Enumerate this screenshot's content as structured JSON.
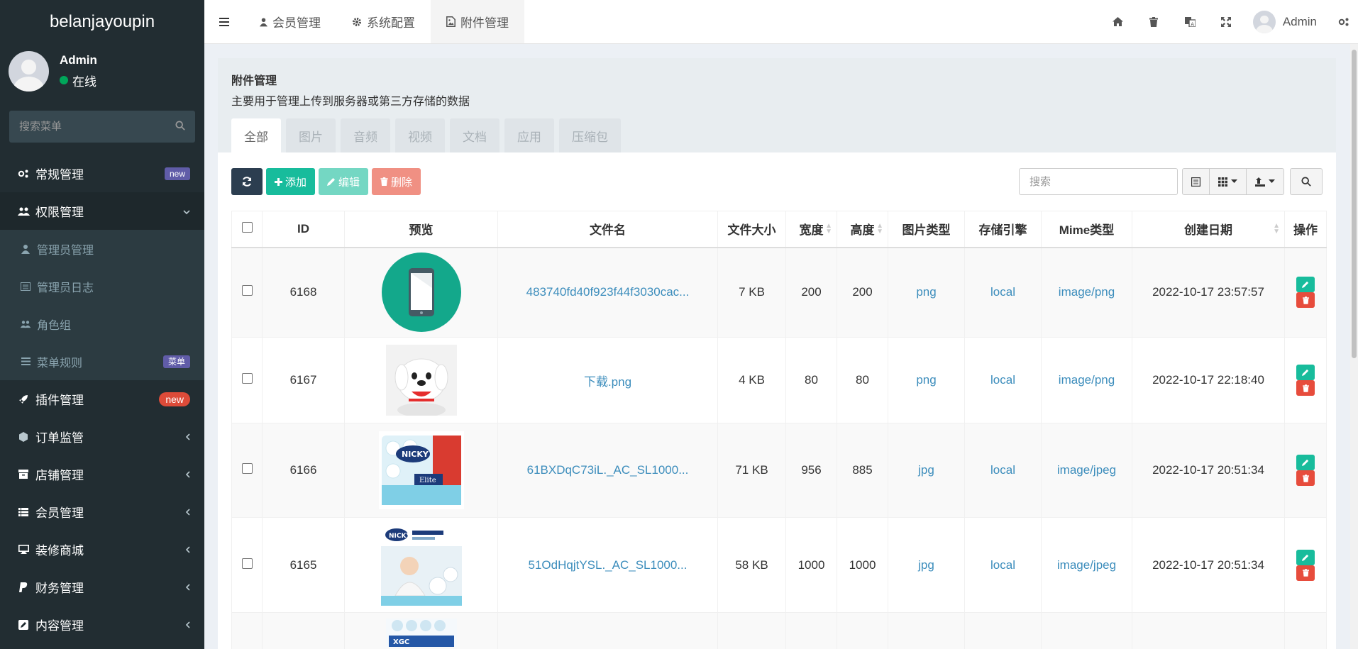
{
  "brand": "belanjayoupin",
  "user": {
    "name": "Admin",
    "status": "在线"
  },
  "sidebar": {
    "search_placeholder": "搜索菜单",
    "items": [
      {
        "label": "常规管理",
        "badge": "new"
      },
      {
        "label": "权限管理"
      },
      {
        "label": "插件管理",
        "badge": "new"
      },
      {
        "label": "订单监管"
      },
      {
        "label": "店铺管理"
      },
      {
        "label": "会员管理"
      },
      {
        "label": "装修商城"
      },
      {
        "label": "财务管理"
      },
      {
        "label": "内容管理"
      }
    ],
    "sub_items": [
      {
        "label": "管理员管理"
      },
      {
        "label": "管理员日志"
      },
      {
        "label": "角色组"
      },
      {
        "label": "菜单规则",
        "badge": "菜单"
      }
    ]
  },
  "topbar": {
    "tabs": [
      {
        "label": "会员管理"
      },
      {
        "label": "系统配置"
      },
      {
        "label": "附件管理"
      }
    ],
    "user_name": "Admin"
  },
  "page": {
    "title": "附件管理",
    "description": "主要用于管理上传到服务器或第三方存储的数据",
    "tabs": [
      "全部",
      "图片",
      "音频",
      "视频",
      "文档",
      "应用",
      "压缩包"
    ]
  },
  "toolbar": {
    "add_label": "添加",
    "edit_label": "编辑",
    "delete_label": "删除",
    "search_placeholder": "搜索"
  },
  "table": {
    "headers": {
      "id": "ID",
      "preview": "预览",
      "filename": "文件名",
      "filesize": "文件大小",
      "width": "宽度",
      "height": "高度",
      "imagetype": "图片类型",
      "storage": "存储引擎",
      "mimetype": "Mime类型",
      "createtime": "创建日期",
      "operate": "操作"
    },
    "rows": [
      {
        "id": "6168",
        "filename": "483740fd40f923f44f3030cac...",
        "filesize": "7 KB",
        "width": "200",
        "height": "200",
        "imagetype": "png",
        "storage": "local",
        "mimetype": "image/png",
        "createtime": "2022-10-17 23:57:57",
        "preview": "phone-icon"
      },
      {
        "id": "6167",
        "filename": "下载.png",
        "filesize": "4 KB",
        "width": "80",
        "height": "80",
        "imagetype": "png",
        "storage": "local",
        "mimetype": "image/png",
        "createtime": "2022-10-17 22:18:40",
        "preview": "dog-mascot"
      },
      {
        "id": "6166",
        "filename": "61BXDqC73iL._AC_SL1000...",
        "filesize": "71 KB",
        "width": "956",
        "height": "885",
        "imagetype": "jpg",
        "storage": "local",
        "mimetype": "image/jpeg",
        "createtime": "2022-10-17 20:51:34",
        "preview": "nicky-elite-pack"
      },
      {
        "id": "6165",
        "filename": "51OdHqjtYSL._AC_SL1000...",
        "filesize": "58 KB",
        "width": "1000",
        "height": "1000",
        "imagetype": "jpg",
        "storage": "local",
        "mimetype": "image/jpeg",
        "createtime": "2022-10-17 20:51:34",
        "preview": "nicky-baby-pack"
      }
    ]
  },
  "colors": {
    "sidebar_bg": "#222d32",
    "link": "#3c8dbc",
    "success": "#18bc9c",
    "danger": "#e74c3c",
    "primary_dark": "#2c3e50",
    "online": "#00a65a"
  }
}
